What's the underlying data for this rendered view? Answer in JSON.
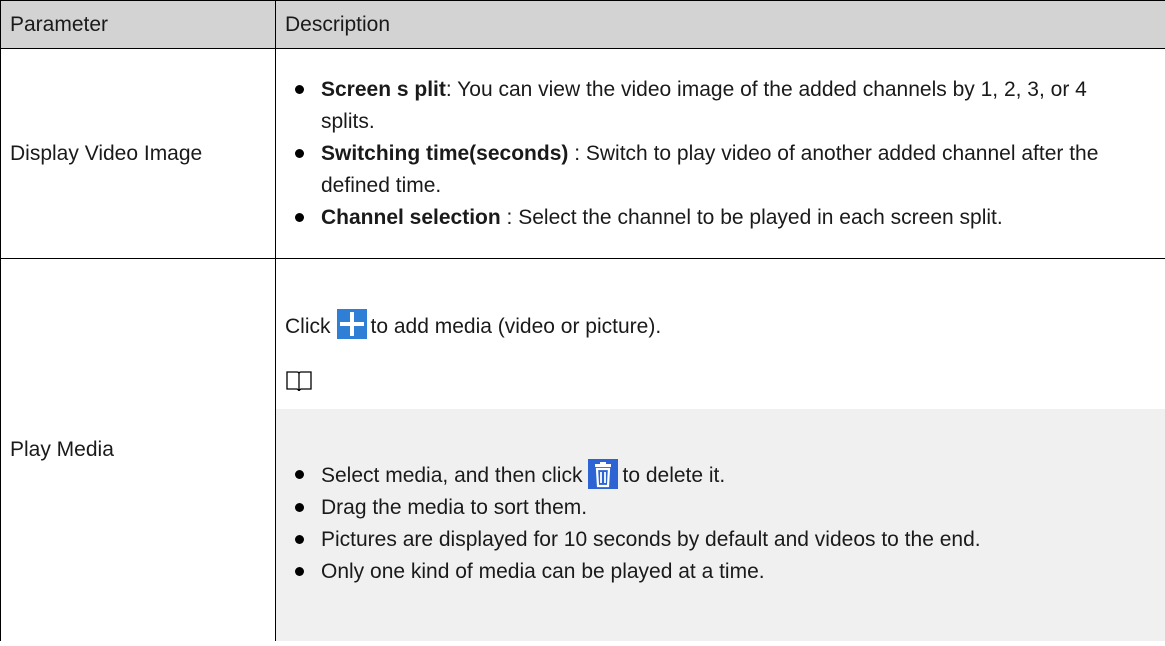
{
  "table": {
    "headers": [
      "Parameter",
      "Description"
    ],
    "row1": {
      "parameter": "Display Video Image",
      "items": [
        {
          "term": "Screen s plit",
          "text": ": You can view the video image of the added channels by 1, 2, 3, or 4 splits."
        },
        {
          "term": "Switching time(seconds)",
          "text": " : Switch to play video of another added channel after the defined time."
        },
        {
          "term": "Channel selection",
          "text": " : Select the channel to be played in each screen split."
        }
      ]
    },
    "row2": {
      "parameter": "Play Media",
      "click_prefix": "Click",
      "click_suffix": "to add media (video or picture).",
      "note_items": [
        {
          "before": "Select media, and then click",
          "after": "to delete it."
        },
        {
          "text": "Drag the media to sort them."
        },
        {
          "text": "Pictures are displayed for 10 seconds by default and videos to the end."
        },
        {
          "text": "Only one kind of media can be played at a time."
        }
      ]
    }
  },
  "icons": {
    "add": "plus-icon",
    "note": "book-icon",
    "delete": "trash-icon",
    "accent": "#2f7fd6"
  }
}
